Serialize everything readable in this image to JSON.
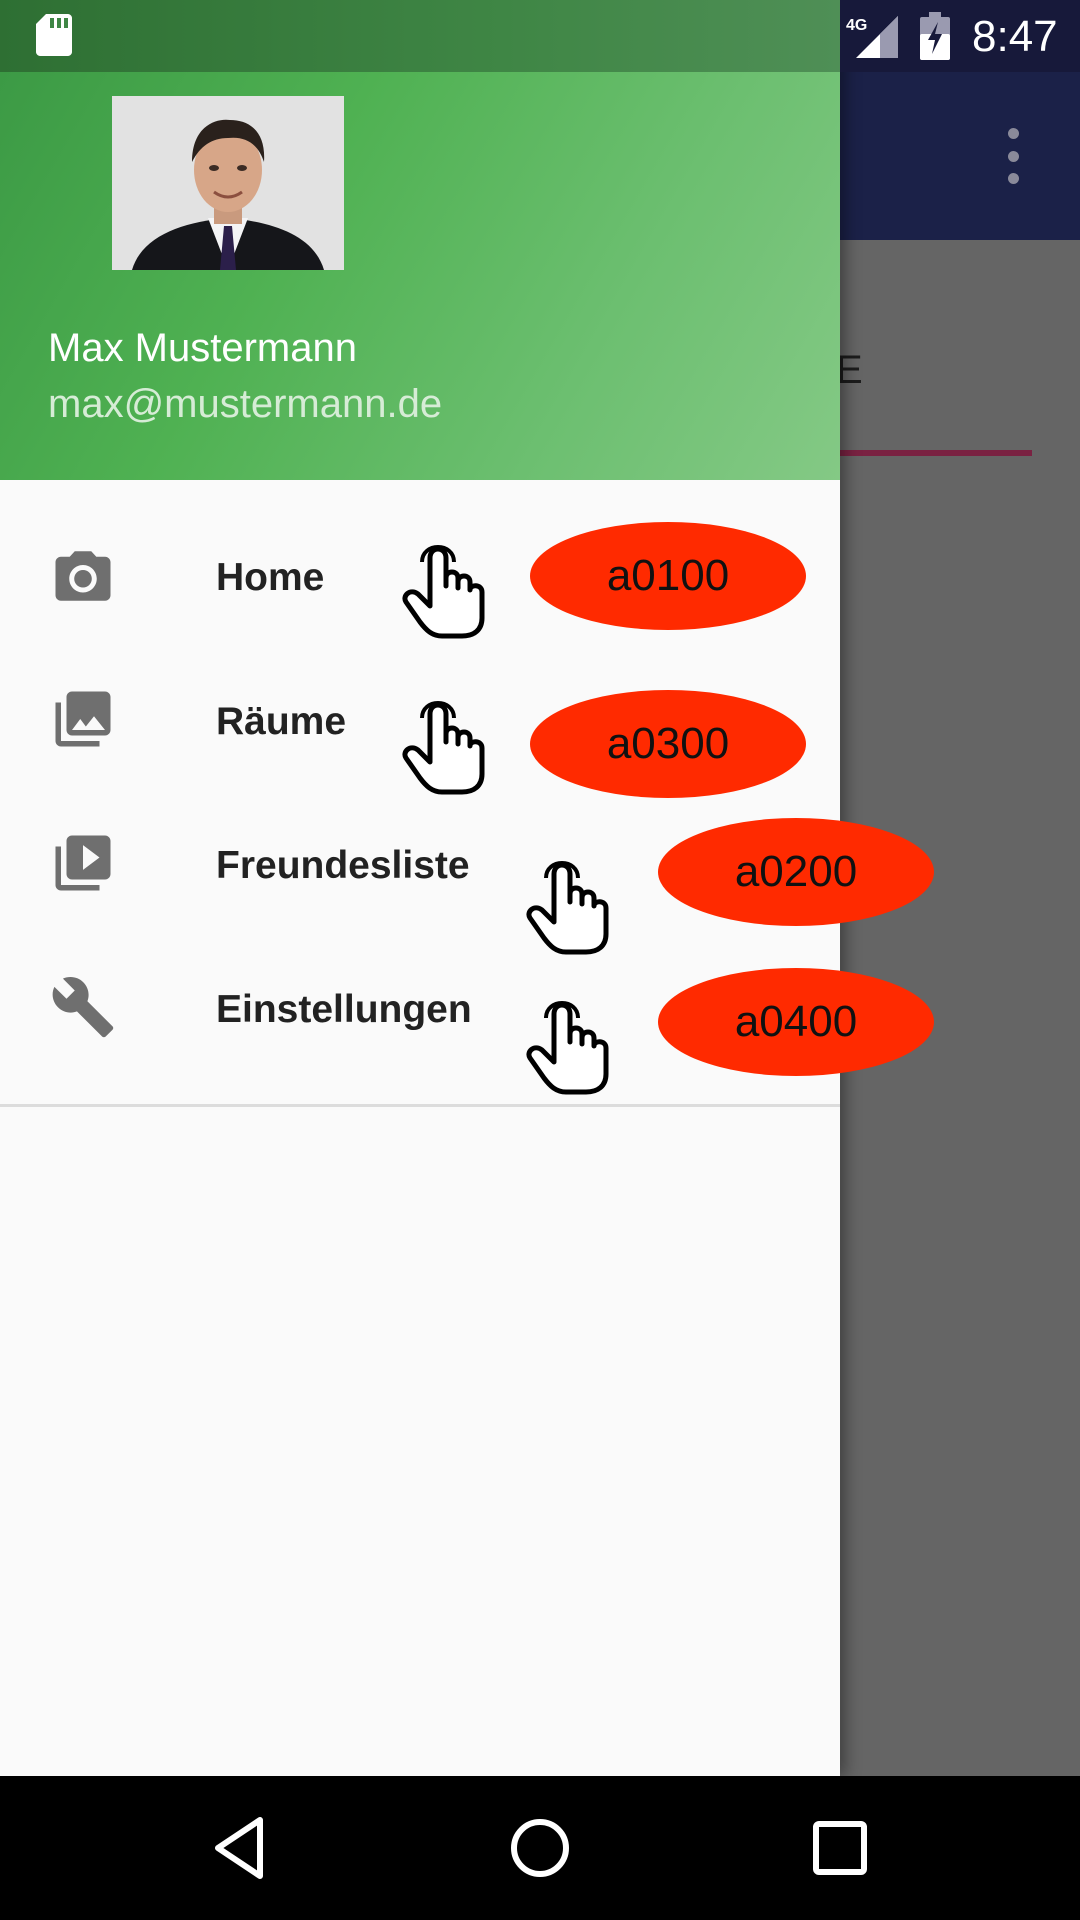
{
  "status_bar": {
    "time": "8:47",
    "network": "4G",
    "icons": [
      "sd-card-icon",
      "signal-4g-icon",
      "battery-charging-icon"
    ]
  },
  "background_app": {
    "toolbar_color": "#1b2148",
    "tab_partial_text": "E",
    "icons": [
      "overflow-menu-icon"
    ]
  },
  "drawer": {
    "header_gradient": [
      "#3c9a45",
      "#84c985"
    ],
    "user": {
      "name": "Max Mustermann",
      "email": "max@mustermann.de"
    },
    "items": [
      {
        "label": "Home",
        "icon": "camera-icon",
        "tag": "a0100"
      },
      {
        "label": "Räume",
        "icon": "photo-library-icon",
        "tag": "a0300"
      },
      {
        "label": "Freundesliste",
        "icon": "video-library-icon",
        "tag": "a0200"
      },
      {
        "label": "Einstellungen",
        "icon": "wrench-icon",
        "tag": "a0400"
      }
    ]
  },
  "annotations": {
    "badge_color": "#ff2a00",
    "pointer_icon": "hand-pointer-icon"
  },
  "nav_bar": {
    "buttons": [
      "back-icon",
      "home-icon",
      "recents-icon"
    ]
  }
}
